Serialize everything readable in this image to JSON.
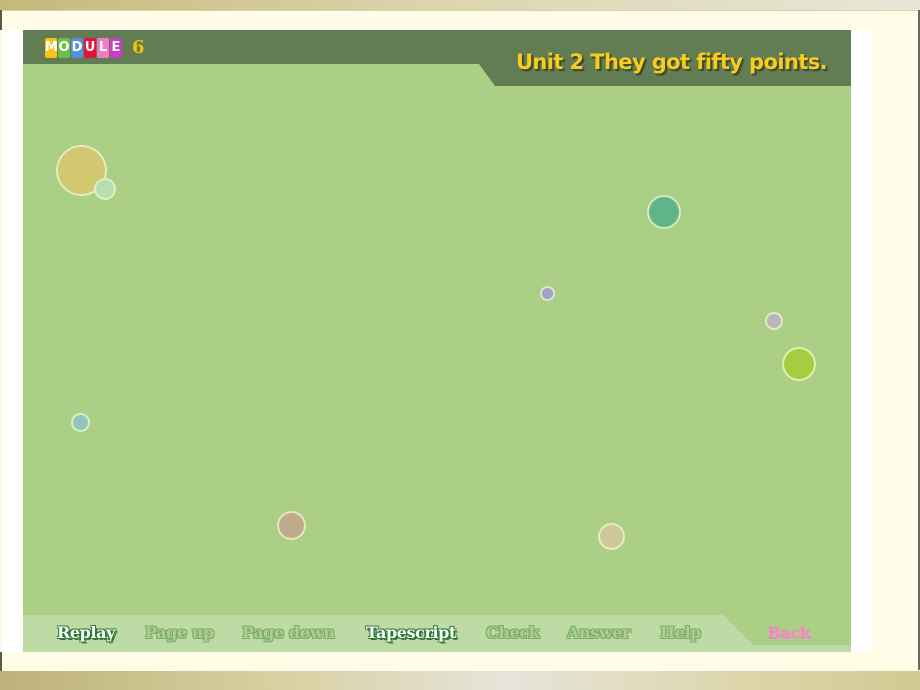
{
  "header": {
    "module_letters": [
      {
        "char": "M",
        "color": "#f8c21c"
      },
      {
        "char": "O",
        "color": "#6cc04a"
      },
      {
        "char": "D",
        "color": "#5a8fe0"
      },
      {
        "char": "U",
        "color": "#e0143c"
      },
      {
        "char": "L",
        "color": "#f27cc0"
      },
      {
        "char": "E",
        "color": "#c840c8"
      }
    ],
    "module_number": "6",
    "unit_title": "Unit 2 They got fifty points."
  },
  "nav": {
    "items": [
      {
        "label": "Replay",
        "state": "active"
      },
      {
        "label": "Page up",
        "state": "disabled"
      },
      {
        "label": "Page down",
        "state": "disabled"
      },
      {
        "label": "Tapescript",
        "state": "active"
      },
      {
        "label": "Check",
        "state": "disabled"
      },
      {
        "label": "Answer",
        "state": "disabled"
      },
      {
        "label": "Help",
        "state": "disabled"
      }
    ],
    "back_label": "Back"
  },
  "colors": {
    "stage_bg": "#aacf85",
    "header_bg": "#627c53",
    "footer_bg": "#bedba6",
    "title_yellow": "#f7cc1c",
    "back_pink": "#f58ab8"
  },
  "bubbles": [
    {
      "name": "bubble-yellow-large",
      "color": "#d2c872"
    },
    {
      "name": "bubble-mint-small",
      "color": "#b6dfae"
    },
    {
      "name": "bubble-teal",
      "color": "#5fb48a"
    },
    {
      "name": "bubble-purple-tiny",
      "color": "#a1a0c8"
    },
    {
      "name": "bubble-grey-small",
      "color": "#b9b5ba"
    },
    {
      "name": "bubble-lime",
      "color": "#a6cc42"
    },
    {
      "name": "bubble-blue-small",
      "color": "#92c6bb"
    },
    {
      "name": "bubble-tan",
      "color": "#bfaa8c"
    },
    {
      "name": "bubble-beige",
      "color": "#cfc79a"
    }
  ]
}
